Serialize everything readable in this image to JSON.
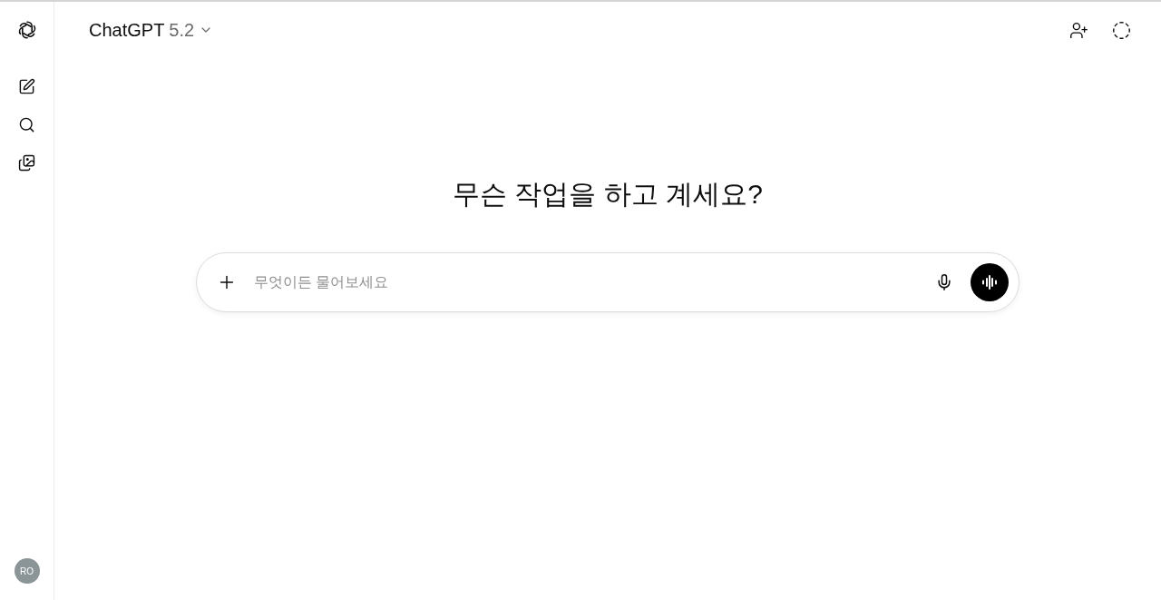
{
  "sidebar": {
    "avatar": {
      "initials": "RO"
    }
  },
  "header": {
    "model_name": "ChatGPT",
    "model_version": "5.2"
  },
  "main": {
    "heading": "무슨 작업을 하고 계세요?",
    "composer": {
      "placeholder": "무엇이든 물어보세요"
    }
  }
}
